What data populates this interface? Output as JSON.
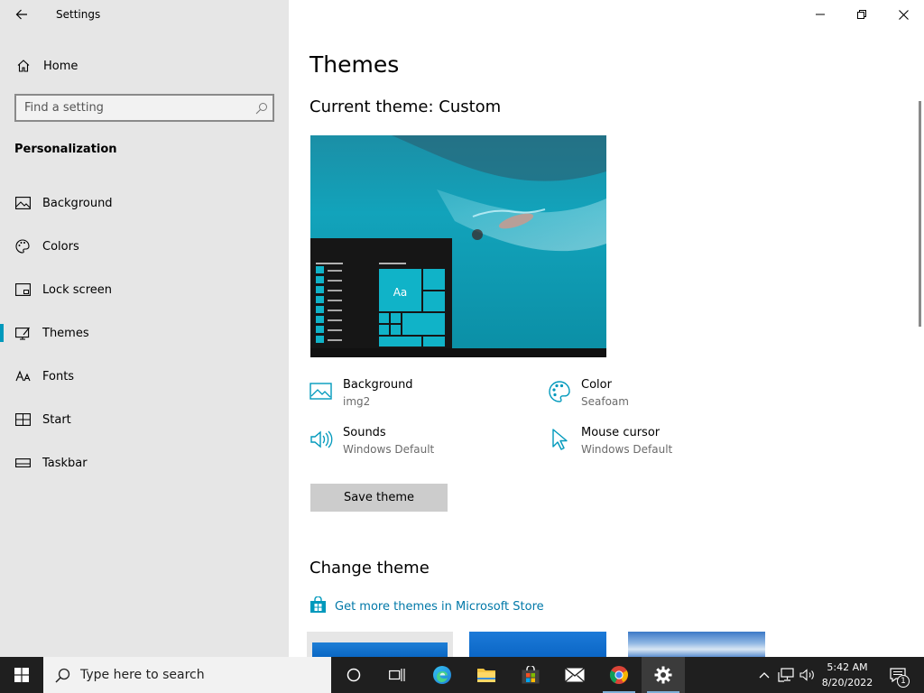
{
  "window": {
    "title": "Settings"
  },
  "sidebar": {
    "home_label": "Home",
    "search_placeholder": "Find a setting",
    "section_title": "Personalization",
    "items": [
      {
        "label": "Background",
        "icon": "picture-icon"
      },
      {
        "label": "Colors",
        "icon": "palette-icon"
      },
      {
        "label": "Lock screen",
        "icon": "lock-screen-icon"
      },
      {
        "label": "Themes",
        "icon": "themes-icon",
        "selected": true
      },
      {
        "label": "Fonts",
        "icon": "fonts-icon"
      },
      {
        "label": "Start",
        "icon": "start-icon"
      },
      {
        "label": "Taskbar",
        "icon": "taskbar-icon"
      }
    ]
  },
  "main": {
    "page_title": "Themes",
    "current_theme": "Current theme: Custom",
    "preview_tile_label": "Aa",
    "properties": [
      {
        "name": "Background",
        "value": "img2",
        "icon": "picture-icon"
      },
      {
        "name": "Color",
        "value": "Seafoam",
        "icon": "palette-icon"
      },
      {
        "name": "Sounds",
        "value": "Windows Default",
        "icon": "speaker-icon"
      },
      {
        "name": "Mouse cursor",
        "value": "Windows Default",
        "icon": "cursor-icon"
      }
    ],
    "save_button": "Save theme",
    "change_theme_heading": "Change theme",
    "store_link": "Get more themes in Microsoft Store"
  },
  "taskbar": {
    "search_placeholder": "Type here to search",
    "time": "5:42 AM",
    "date": "8/20/2022",
    "notification_count": "1"
  },
  "colors": {
    "accent": "#0099bc",
    "sidebar_bg": "#e6e6e6",
    "link": "#0078a8",
    "taskbar_bg": "#1f1f1f"
  }
}
